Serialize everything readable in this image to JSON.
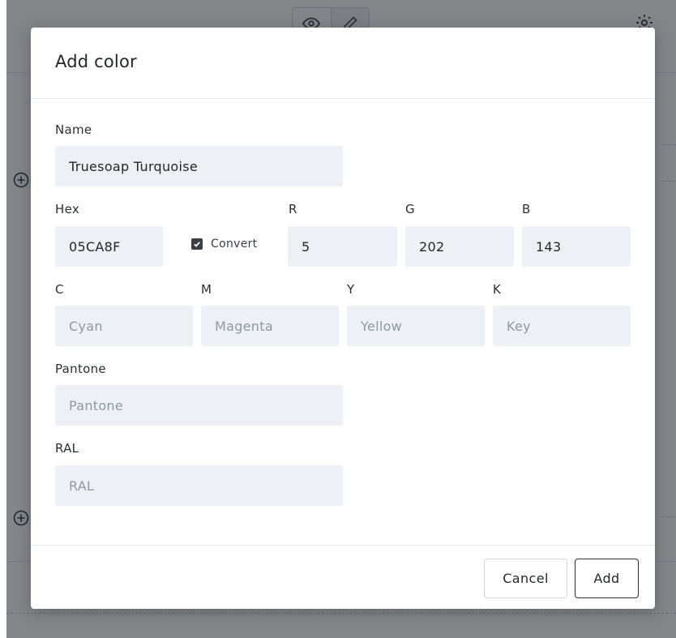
{
  "modal": {
    "title": "Add color",
    "fields": {
      "name": {
        "label": "Name",
        "value": "Truesoap Turquoise",
        "placeholder": ""
      },
      "hex": {
        "label": "Hex",
        "value": "05CA8F",
        "placeholder": ""
      },
      "convert": {
        "label": "Convert",
        "checked": true
      },
      "r": {
        "label": "R",
        "value": "5",
        "placeholder": ""
      },
      "g": {
        "label": "G",
        "value": "202",
        "placeholder": ""
      },
      "b": {
        "label": "B",
        "value": "143",
        "placeholder": ""
      },
      "c": {
        "label": "C",
        "value": "",
        "placeholder": "Cyan"
      },
      "m": {
        "label": "M",
        "value": "",
        "placeholder": "Magenta"
      },
      "y": {
        "label": "Y",
        "value": "",
        "placeholder": "Yellow"
      },
      "k": {
        "label": "K",
        "value": "",
        "placeholder": "Key"
      },
      "pantone": {
        "label": "Pantone",
        "value": "",
        "placeholder": "Pantone"
      },
      "ral": {
        "label": "RAL",
        "value": "",
        "placeholder": "RAL"
      }
    },
    "buttons": {
      "cancel": "Cancel",
      "add": "Add"
    }
  },
  "background": {
    "toolbar_icons": [
      "eye-icon",
      "pencil-icon",
      "gear-icon",
      "more-icon"
    ],
    "row_add_icons": [
      "plus-circle-icon",
      "plus-circle-icon"
    ]
  },
  "colors": {
    "overlay": "#1e2228",
    "field_bg": "#edf1f5",
    "placeholder": "#8f98a3",
    "text": "#23272b",
    "border": "#d4d8dd"
  }
}
